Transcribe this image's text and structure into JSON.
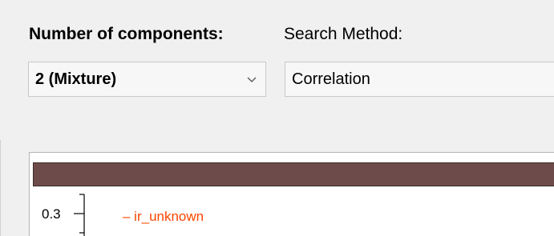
{
  "labels": {
    "components": "Number of components:",
    "search_method": "Search Method:"
  },
  "components_select": {
    "value": "2 (Mixture)"
  },
  "method_select": {
    "value": "Correlation"
  },
  "plot": {
    "bar_color": "#6e4b4b",
    "ytick": "0.3",
    "legend_label": "– ir_unknown",
    "legend_color": "#ff4500"
  }
}
